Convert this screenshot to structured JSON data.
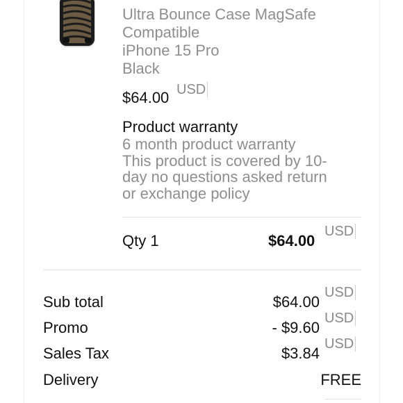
{
  "product": {
    "title_lines": [
      "Ultra Bounce Case MagSafe",
      "Compatible",
      "iPhone 15 Pro",
      "Black"
    ],
    "price": "$64.00",
    "currency": "USD",
    "thumbnail_icon": "phone-case-thumbnail"
  },
  "warranty": {
    "title": "Product warranty",
    "lines": [
      "6 month product warranty",
      "This product is covered by 10-",
      "day no questions asked return",
      "or exchange policy"
    ]
  },
  "quantity": {
    "label": "Qty 1",
    "price": "$64.00",
    "currency": "USD"
  },
  "summary": {
    "rows": [
      {
        "label": "Sub total",
        "value": "$64.00",
        "currency": "USD"
      },
      {
        "label": "Promo",
        "value": "- $9.60",
        "currency": "USD"
      },
      {
        "label": "Sales Tax",
        "value": "$3.84",
        "currency": "USD"
      },
      {
        "label": "Delivery",
        "value": "FREE"
      }
    ]
  },
  "colors": {
    "muted_text": "#8e8e8e",
    "primary_text": "#111111",
    "divider": "#e2e2e2"
  }
}
